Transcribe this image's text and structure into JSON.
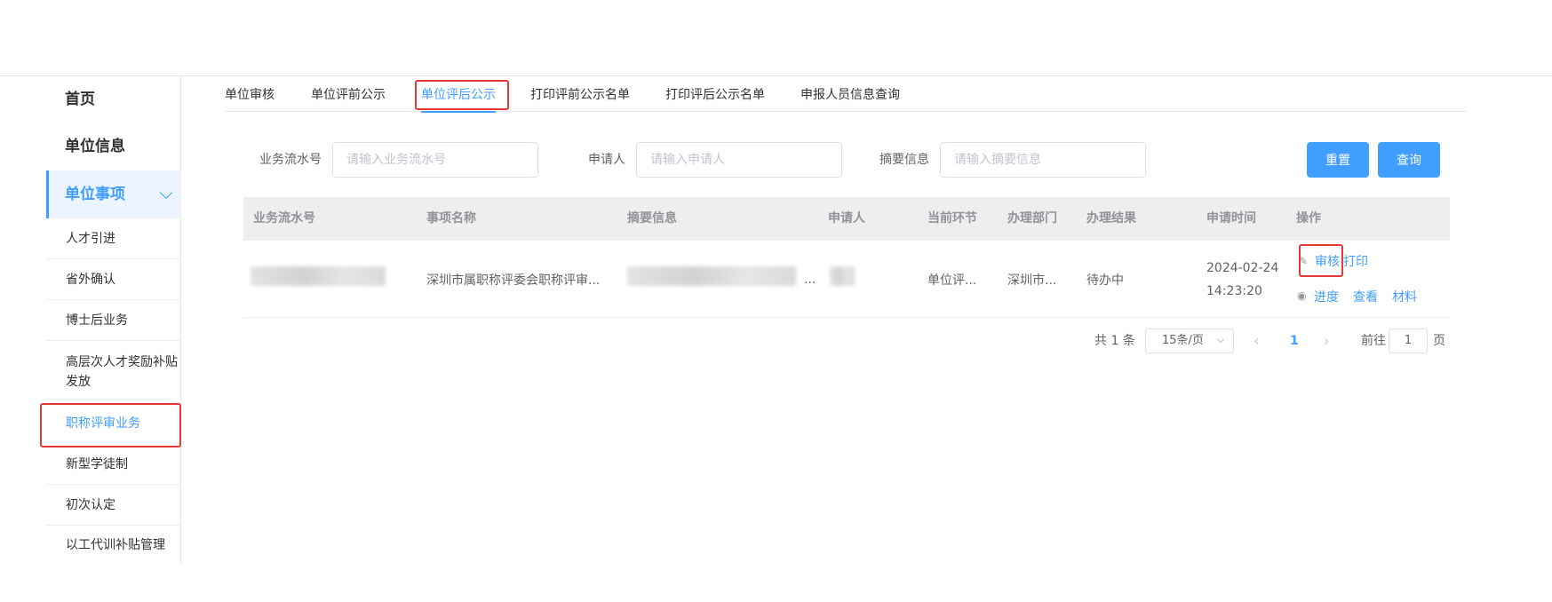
{
  "sidebar": {
    "top_items": [
      "首页",
      "单位信息"
    ],
    "active_group": "单位事项",
    "sub_items": [
      "人才引进",
      "省外确认",
      "博士后业务",
      "高层次人才奖励补贴发放",
      "职称评审业务",
      "新型学徒制",
      "初次认定",
      "以工代训补贴管理"
    ]
  },
  "tabs": [
    "单位审核",
    "单位评前公示",
    "单位评后公示",
    "打印评前公示名单",
    "打印评后公示名单",
    "申报人员信息查询"
  ],
  "filters": {
    "flow_label": "业务流水号",
    "flow_placeholder": "请输入业务流水号",
    "applicant_label": "申请人",
    "applicant_placeholder": "请输入申请人",
    "summary_label": "摘要信息",
    "summary_placeholder": "请输入摘要信息",
    "reset": "重置",
    "query": "查询"
  },
  "table": {
    "headers": [
      "业务流水号",
      "事项名称",
      "摘要信息",
      "申请人",
      "当前环节",
      "办理部门",
      "办理结果",
      "申请时间",
      "操作"
    ],
    "row": {
      "item_name": "深圳市属职称评委会职称评审...",
      "summary_tail": "...",
      "stage": "单位评...",
      "dept": "深圳市...",
      "result": "待办中",
      "date": "2024-02-24",
      "time": "14:23:20",
      "ops": [
        "审核",
        "打印",
        "进度",
        "查看",
        "材料"
      ]
    }
  },
  "pagination": {
    "total": "共 1 条",
    "page_size": "15条/页",
    "current": "1",
    "goto_prefix": "前往",
    "goto_value": "1",
    "goto_suffix": "页"
  },
  "colors": {
    "primary": "#409eff",
    "highlight": "#e53935"
  }
}
